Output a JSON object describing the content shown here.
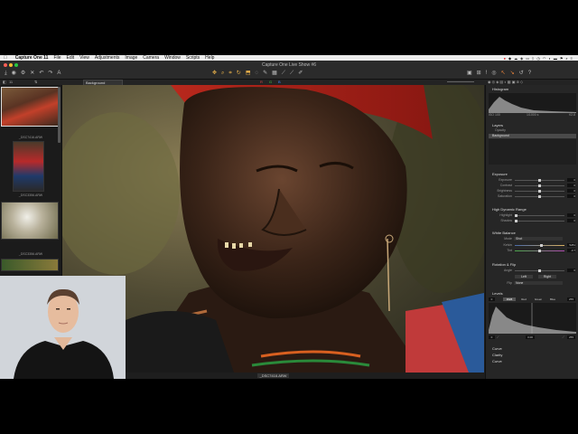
{
  "menubar": {
    "apple": "",
    "app_name": "Capture One 11",
    "items": [
      "File",
      "Edit",
      "View",
      "Adjustments",
      "Image",
      "Camera",
      "Window",
      "Scripts",
      "Help"
    ]
  },
  "window": {
    "title": "Capture One Live Show #6"
  },
  "browser": {
    "count": "11",
    "thumbnails": [
      {
        "label": "_DSC7416.ARW",
        "selected": true
      },
      {
        "label": "_DSC3356.ARW",
        "selected": false
      },
      {
        "label": "_DSC3356.ARW",
        "selected": false
      },
      {
        "label": "",
        "selected": false
      }
    ]
  },
  "layer_selector": {
    "value": "Background"
  },
  "viewer": {
    "filename": "_DSC7416.ARW"
  },
  "tools": {
    "histogram": {
      "title": "Histogram",
      "iso": "ISO 100",
      "shutter": "1/1000 s",
      "aperture": "f/2.8"
    },
    "layers": {
      "title": "Layers",
      "opacity_label": "Opacity",
      "background_label": "Background"
    },
    "exposure": {
      "title": "Exposure",
      "rows": [
        {
          "label": "Exposure",
          "value": "0"
        },
        {
          "label": "Contrast",
          "value": "0"
        },
        {
          "label": "Brightness",
          "value": "0"
        },
        {
          "label": "Saturation",
          "value": "0"
        }
      ]
    },
    "hdr": {
      "title": "High Dynamic Range",
      "rows": [
        {
          "label": "Highlight",
          "value": "0"
        },
        {
          "label": "Shadow",
          "value": "0"
        }
      ]
    },
    "white_balance": {
      "title": "White Balance",
      "mode_label": "Mode",
      "mode_value": "Shot",
      "rows": [
        {
          "label": "Kelvin",
          "value": "5281"
        },
        {
          "label": "Tint",
          "value": "-0.7"
        }
      ]
    },
    "rotation": {
      "title": "Rotation & Flip",
      "angle_label": "Angle",
      "angle_value": "0",
      "left_button": "Left",
      "right_button": "Right",
      "flip_label": "Flip",
      "flip_value": "None"
    },
    "levels": {
      "title": "Levels",
      "channel_tabs": [
        "RGB",
        "Red",
        "Green",
        "Blue"
      ],
      "low": "0",
      "high": "255",
      "out_low": "0",
      "out_high": "255",
      "midpoint": "0.00"
    },
    "collapsed_sections": [
      "Curve",
      "Clarity",
      "Curve"
    ]
  }
}
